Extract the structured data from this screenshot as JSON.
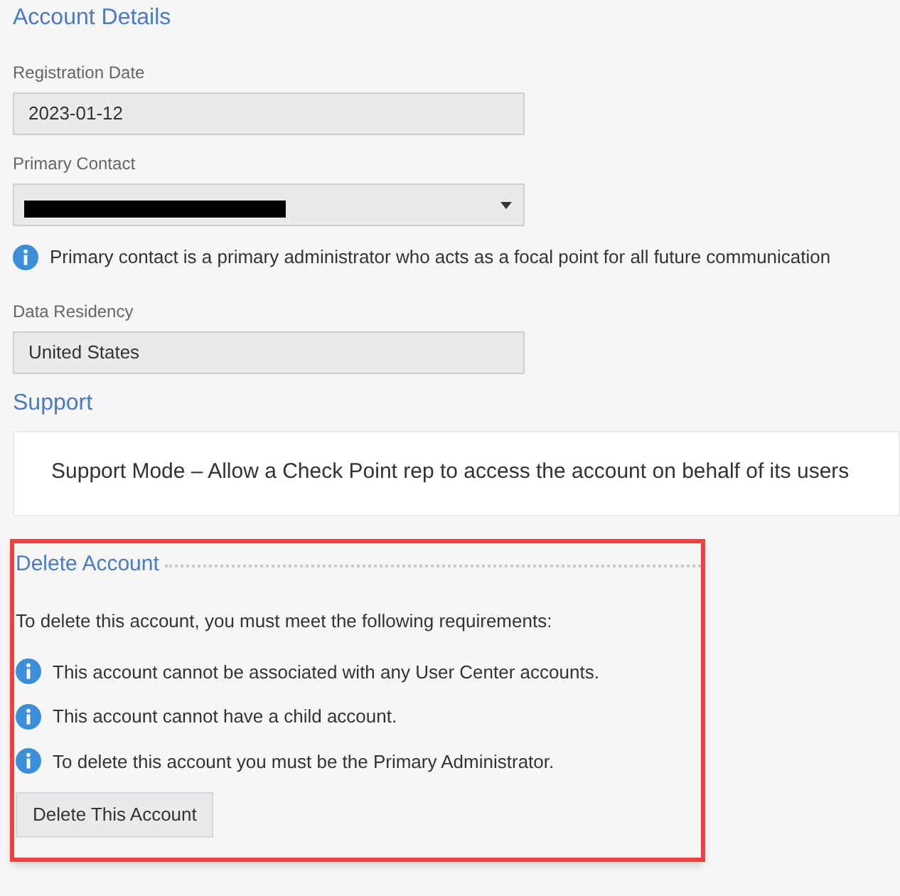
{
  "account_details": {
    "title": "Account Details",
    "fields": [
      {
        "label": "Registration Date",
        "value": "2023-01-12",
        "kind": "text"
      },
      {
        "label": "Primary Contact",
        "kind": "redacted_select"
      }
    ],
    "info": "Primary contact is a primary administrator who acts as a focal point for all future communication",
    "data_residency": {
      "label": "Data Residency",
      "value": "United States"
    }
  },
  "support": {
    "title": "Support",
    "text": "Support Mode – Allow a Check Point rep to access the account on behalf of its users"
  },
  "delete_account": {
    "title": "Delete Account",
    "intro": "To delete this account, you must meet the following requirements:",
    "requirements": [
      "This account cannot be associated with any User Center accounts.",
      "This account cannot have a child account.",
      "To delete this account you must be the Primary Administrator."
    ],
    "button": "Delete This Account"
  }
}
